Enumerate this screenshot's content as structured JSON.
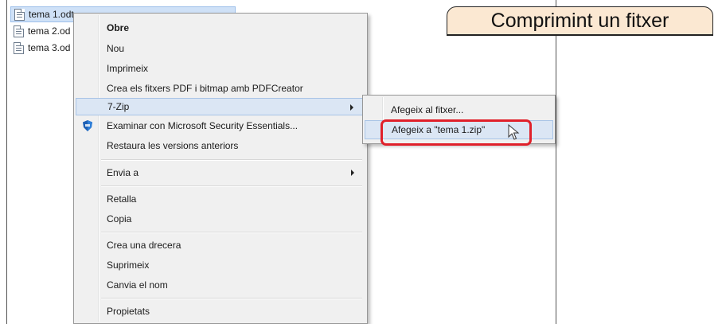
{
  "title_banner": {
    "text": "Comprimint un fitxer"
  },
  "files": [
    {
      "name": "tema 1.odt",
      "selected": true
    },
    {
      "name": "tema 2.od",
      "selected": false
    },
    {
      "name": "tema 3.od",
      "selected": false
    }
  ],
  "context_menu": {
    "items": [
      {
        "label": "Obre",
        "bold": true
      },
      {
        "label": "Nou"
      },
      {
        "label": "Imprimeix"
      },
      {
        "label": "Crea els fitxers PDF i bitmap amb PDFCreator"
      },
      {
        "label": "7-Zip",
        "submenu": true,
        "hover": true
      },
      {
        "label": "Examinar con Microsoft Security Essentials...",
        "icon": "shield-icon"
      },
      {
        "label": "Restaura les versions anteriors"
      },
      {
        "label": "Envia a",
        "submenu": true
      },
      {
        "label": "Retalla"
      },
      {
        "label": "Copia"
      },
      {
        "label": "Crea una drecera"
      },
      {
        "label": "Suprimeix"
      },
      {
        "label": "Canvia el nom"
      },
      {
        "label": "Propietats"
      }
    ]
  },
  "submenu_7zip": {
    "items": [
      {
        "label": "Afegeix al fitxer..."
      },
      {
        "label": "Afegeix a \"tema 1.zip\"",
        "hover": true
      }
    ]
  },
  "colors": {
    "highlight": "#e0202a",
    "banner_bg": "#fbe8d2",
    "selection": "#cfe1f7"
  }
}
